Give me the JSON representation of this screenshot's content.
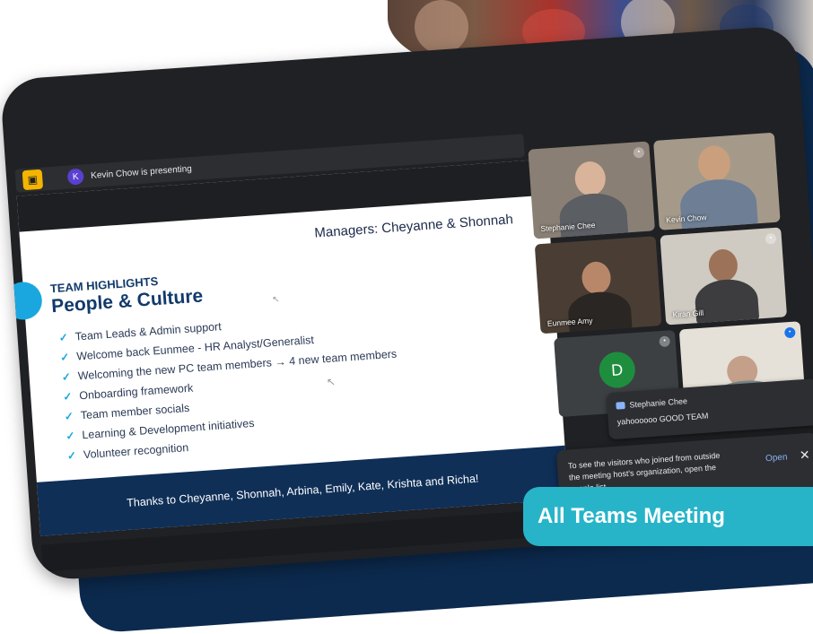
{
  "presenter": {
    "initial": "K",
    "text": "Kevin Chow is presenting"
  },
  "slide": {
    "managers": "Managers: Cheyanne & Shonnah",
    "kicker": "TEAM HIGHLIGHTS",
    "title": "People & Culture",
    "bullets": [
      "Team Leads & Admin support",
      "Welcome back Eunmee - HR Analyst/Generalist",
      "Welcoming the new PC team members → 4 new team members",
      "Onboarding framework",
      "Team member socials",
      "Learning & Development initiatives",
      "Volunteer recognition"
    ],
    "thanks": "Thanks to Cheyanne, Shonnah, Arbina, Emily, Kate, Krishta and Richa!"
  },
  "participants": [
    {
      "name": "Stephanie Chee"
    },
    {
      "name": "Kevin Chow"
    },
    {
      "name": "Eunmee Amy"
    },
    {
      "name": "Kiran Gill"
    },
    {
      "name": "D",
      "initial": "D"
    }
  ],
  "chat": {
    "sender": "Stephanie Chee",
    "message": "yahoooooo GOOD TEAM"
  },
  "visitor_notice": {
    "text": "To see the visitors who joined from outside the meeting host's organization, open the people list",
    "open_label": "Open",
    "close_label": "✕"
  },
  "banner": {
    "label": "All Teams Meeting"
  },
  "colors": {
    "navy": "#0c2a4e",
    "accent": "#27b4c9",
    "slide_blue": "#123a6b"
  }
}
